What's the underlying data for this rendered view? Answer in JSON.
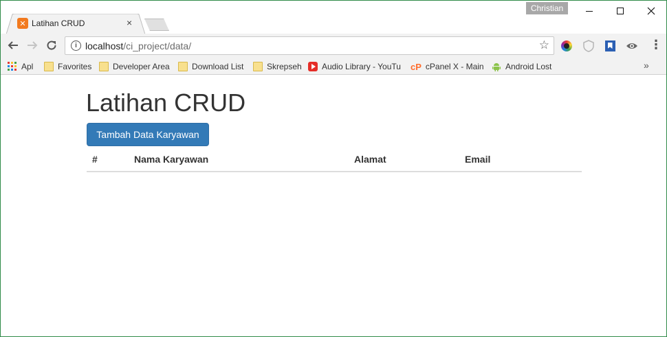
{
  "browser": {
    "profile_name": "Christian",
    "tab": {
      "title": "Latihan CRUD",
      "close_glyph": "×"
    },
    "url": {
      "host": "localhost",
      "path": "/ci_project/data/"
    },
    "bookmarks": [
      {
        "label": "Apl",
        "icon": "apps-grid-icon"
      },
      {
        "label": "Favorites",
        "icon": "folder-icon"
      },
      {
        "label": "Developer Area",
        "icon": "folder-icon"
      },
      {
        "label": "Download List",
        "icon": "folder-icon"
      },
      {
        "label": "Skrepseh",
        "icon": "folder-icon"
      },
      {
        "label": "Audio Library - YouTu",
        "icon": "youtube-icon"
      },
      {
        "label": "cPanel X - Main",
        "icon": "cpanel-icon"
      },
      {
        "label": "Android Lost",
        "icon": "android-icon"
      }
    ]
  },
  "page": {
    "title": "Latihan CRUD",
    "add_button_label": "Tambah Data Karyawan",
    "table": {
      "headers": [
        "#",
        "Nama Karyawan",
        "Alamat",
        "Email"
      ],
      "rows": []
    }
  },
  "colors": {
    "primary_button": "#337ab7",
    "window_border": "#2f8a48"
  }
}
